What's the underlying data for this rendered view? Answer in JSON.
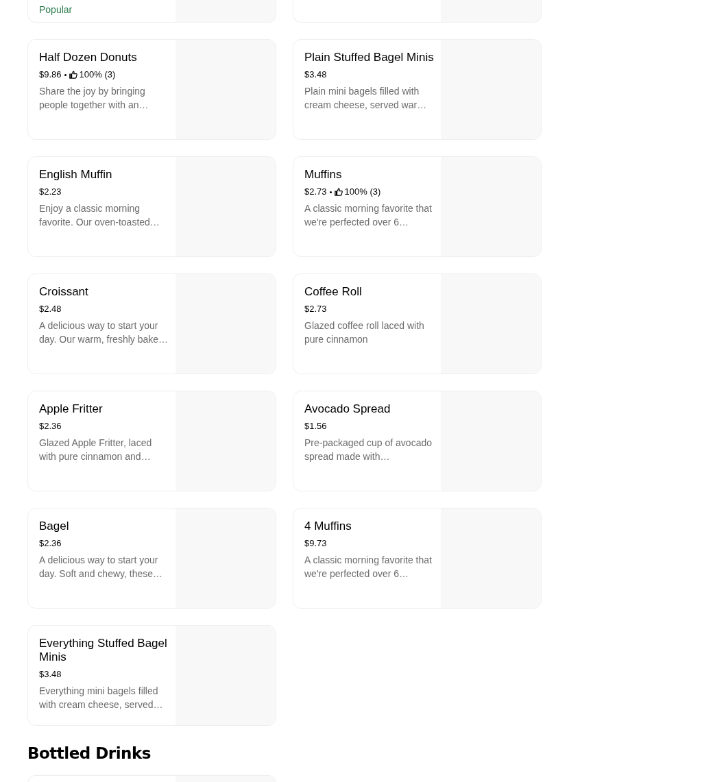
{
  "top_row": {
    "badge": "Popular"
  },
  "items": [
    {
      "name": "Half Dozen Donuts",
      "price": "$9.86",
      "rating": "100% (3)",
      "description": "Share the joy by bringing people together with an…"
    },
    {
      "name": "Plain Stuffed Bagel Minis",
      "price": "$3.48",
      "description": "Plain mini bagels filled with cream cheese, served war…"
    },
    {
      "name": "English Muffin",
      "price": "$2.23",
      "description": "Enjoy a classic morning favorite. Our oven-toasted…"
    },
    {
      "name": "Muffins",
      "price": "$2.73",
      "rating": "100% (3)",
      "description": "A classic morning favorite that we're perfected over 6…"
    },
    {
      "name": "Croissant",
      "price": "$2.48",
      "description": "A delicious way to start your day. Our warm, freshly bake…"
    },
    {
      "name": "Coffee Roll",
      "price": "$2.73",
      "description": "Glazed coffee roll laced with pure cinnamon"
    },
    {
      "name": "Apple Fritter",
      "price": "$2.36",
      "description": "Glazed Apple Fritter, laced with pure cinnamon and…"
    },
    {
      "name": "Avocado Spread",
      "price": "$1.56",
      "description": "Pre-packaged cup of avocado spread made with…"
    },
    {
      "name": "Bagel",
      "price": "$2.36",
      "description": "A delicious way to start your day. Soft and chewy, these…"
    },
    {
      "name": "4 Muffins",
      "price": "$9.73",
      "description": "A classic morning favorite that we're perfected over 6…"
    },
    {
      "name": "Everything Stuffed Bagel Minis",
      "price": "$3.48",
      "description": "Everything mini bagels filled with cream cheese, served…"
    }
  ],
  "next_section": {
    "title": "Bottled Drinks"
  }
}
